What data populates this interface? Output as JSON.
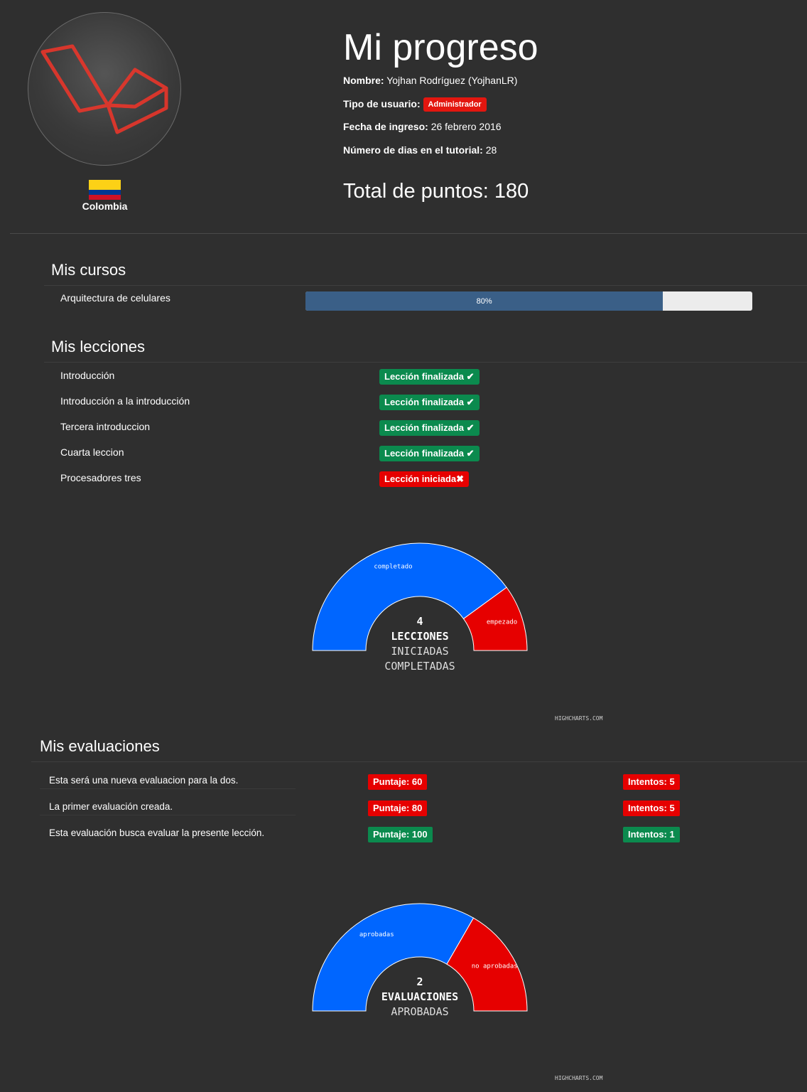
{
  "profile": {
    "country": "Colombia",
    "flag_colors": [
      "#fcd116",
      "#003893",
      "#ce1126"
    ]
  },
  "header": {
    "title": "Mi progreso",
    "name_label": "Nombre:",
    "name_value": "Yojhan Rodríguez (YojhanLR)",
    "user_type_label": "Tipo de usuario:",
    "user_type_value": "Administrador",
    "join_date_label": "Fecha de ingreso:",
    "join_date_value": "26 febrero 2016",
    "days_label": "Número de dias en el tutorial:",
    "days_value": "28",
    "total_points": "Total de puntos: 180"
  },
  "courses": {
    "title": "Mis cursos",
    "items": [
      {
        "name": "Arquitectura de celulares",
        "progress": 80,
        "progress_label": "80%"
      }
    ]
  },
  "lessons": {
    "title": "Mis lecciones",
    "items": [
      {
        "name": "Introducción",
        "status": "Lección finalizada",
        "state": "done"
      },
      {
        "name": "Introducción a la introducción",
        "status": "Lección finalizada",
        "state": "done"
      },
      {
        "name": "Tercera introduccion",
        "status": "Lección finalizada",
        "state": "done"
      },
      {
        "name": "Cuarta leccion",
        "status": "Lección finalizada",
        "state": "done"
      },
      {
        "name": "Procesadores tres",
        "status": "Lección iniciada",
        "state": "started"
      }
    ]
  },
  "evaluations": {
    "title": "Mis evaluaciones",
    "items": [
      {
        "name": "Esta será una nueva evaluacion para la dos.",
        "score": "Puntaje: 60",
        "attempts": "Intentos: 5",
        "passed": false
      },
      {
        "name": "La primer evaluación creada.",
        "score": "Puntaje: 80",
        "attempts": "Intentos: 5",
        "passed": false
      },
      {
        "name": "Esta evaluación busca evaluar la presente lección.",
        "score": "Puntaje: 100",
        "attempts": "Intentos: 1",
        "passed": true
      }
    ]
  },
  "colors": {
    "blue": "#0066ff",
    "red": "#e60000",
    "green": "#0b8a4e",
    "progress": "#3a5f87"
  },
  "credits": "HIGHCHARTS.COM",
  "chart_data": [
    {
      "type": "pie",
      "subtype": "semi-donut",
      "series": [
        {
          "name": "completado",
          "value": 4
        },
        {
          "name": "empezado",
          "value": 1
        }
      ],
      "center_lines": [
        "4",
        "LECCIONES",
        "INICIADAS",
        "COMPLETADAS"
      ]
    },
    {
      "type": "pie",
      "subtype": "semi-donut",
      "series": [
        {
          "name": "aprobadas",
          "value": 2
        },
        {
          "name": "no aprobadas",
          "value": 1
        }
      ],
      "center_lines": [
        "2",
        "EVALUACIONES",
        "APROBADAS"
      ]
    }
  ]
}
